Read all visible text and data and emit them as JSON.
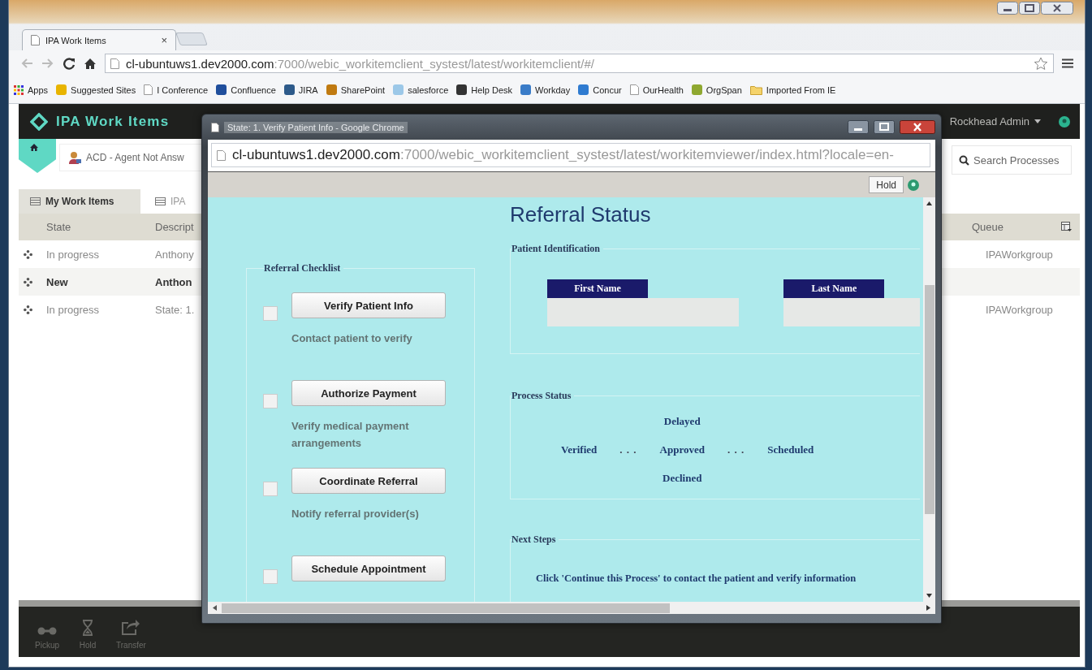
{
  "browser": {
    "tab_title": "IPA Work Items",
    "tab_close": "×",
    "url_host": "cl-ubuntuws1.dev2000.com",
    "url_path": ":7000/webic_workitemclient_systest/latest/workitemclient/#/"
  },
  "bookmarks": [
    {
      "label": "Apps",
      "kind": "apps"
    },
    {
      "label": "Suggested Sites",
      "kind": "logo",
      "color": "#e8b400"
    },
    {
      "label": "I Conference",
      "kind": "page"
    },
    {
      "label": "Confluence",
      "kind": "logo",
      "color": "#1f4e9c"
    },
    {
      "label": "JIRA",
      "kind": "logo",
      "color": "#2d5a8a"
    },
    {
      "label": "SharePoint",
      "kind": "logo",
      "color": "#c07a10"
    },
    {
      "label": "salesforce",
      "kind": "logo",
      "color": "#9cc8e8"
    },
    {
      "label": "Help Desk",
      "kind": "logo",
      "color": "#333333"
    },
    {
      "label": "Workday",
      "kind": "logo",
      "color": "#3a7cc8"
    },
    {
      "label": "Concur",
      "kind": "logo",
      "color": "#2f7bd0"
    },
    {
      "label": "OurHealth",
      "kind": "page"
    },
    {
      "label": "OrgSpan",
      "kind": "logo",
      "color": "#8fa830"
    },
    {
      "label": "Imported From IE",
      "kind": "folder"
    }
  ],
  "app": {
    "title": "IPA Work Items",
    "user": "Rockhead Admin",
    "queue_item": "ACD - Agent Not Answ",
    "search_placeholder": "Search Processes"
  },
  "tabs": [
    {
      "label": "My Work Items",
      "selected": true
    },
    {
      "label": "IPA",
      "selected": false
    }
  ],
  "table": {
    "columns": [
      "State",
      "Descript",
      "Queue"
    ],
    "rows": [
      {
        "state": "In progress",
        "description": "Anthony",
        "queue": "IPAWorkgroup",
        "unread": false,
        "selected": false
      },
      {
        "state": "New",
        "description": "Anthon",
        "unread": true,
        "selected": true
      },
      {
        "state": "In progress",
        "description": "State: 1.",
        "queue": "IPAWorkgroup",
        "unread": false,
        "selected": false
      }
    ]
  },
  "actions": [
    {
      "label": "Pickup",
      "kind": "pickup"
    },
    {
      "label": "Hold",
      "kind": "hold"
    },
    {
      "label": "Transfer",
      "kind": "transfer"
    }
  ],
  "popup": {
    "title": "State: 1. Verify Patient Info - Google Chrome",
    "url_host": "cl-ubuntuws1.dev2000.com",
    "url_path": ":7000/webic_workitemclient_systest/latest/workitemviewer/index.html?locale=en-",
    "hold": "Hold",
    "heading": "Referral Status",
    "checklist": {
      "legend": "Referral Checklist",
      "items": [
        {
          "button": "Verify Patient Info",
          "note": "Contact patient to verify",
          "checked": false
        },
        {
          "button": "Authorize Payment",
          "note": "Verify medical payment arrangements",
          "checked": false
        },
        {
          "button": "Coordinate Referral",
          "note": "Notify referral provider(s)",
          "checked": false
        },
        {
          "button": "Schedule Appointment",
          "checked": false
        }
      ]
    },
    "patient": {
      "legend": "Patient Identification",
      "fields": [
        {
          "label": "First Name"
        },
        {
          "label": "Last Name"
        }
      ]
    },
    "process": {
      "legend": "Process Status",
      "items": [
        {
          "kind": "stage",
          "labels": [
            "Verified"
          ]
        },
        {
          "kind": "separator",
          "labels": [
            ". . ."
          ]
        },
        {
          "kind": "stage",
          "labels": [
            "Delayed",
            "Approved",
            "Declined"
          ]
        },
        {
          "kind": "separator",
          "labels": [
            ". . ."
          ]
        },
        {
          "kind": "stage",
          "labels": [
            "Scheduled"
          ]
        }
      ]
    },
    "next": {
      "legend": "Next Steps",
      "text": "Click 'Continue this Process' to contact the patient and verify information"
    }
  }
}
